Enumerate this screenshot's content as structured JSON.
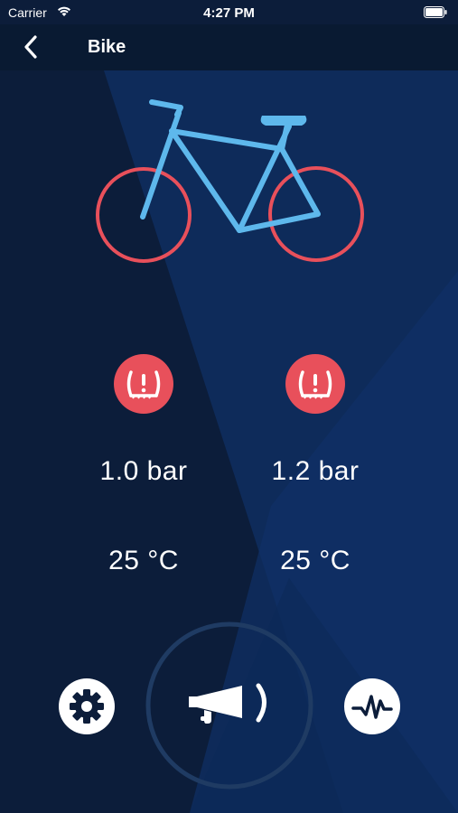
{
  "status": {
    "carrier": "Carrier",
    "time": "4:27 PM"
  },
  "nav": {
    "title": "Bike",
    "back_icon": "chevron-left-icon"
  },
  "colors": {
    "background": "#0c1d3a",
    "bike_frame": "#5eb8ec",
    "wheel": "#e8505b",
    "alert": "#e8505b"
  },
  "sensors": {
    "front": {
      "pressure": "1.0 bar",
      "temperature": "25 °C",
      "icon": "tire-pressure-warning-icon"
    },
    "rear": {
      "pressure": "1.2 bar",
      "temperature": "25 °C",
      "icon": "tire-pressure-warning-icon"
    }
  },
  "controls": {
    "settings_icon": "gear-icon",
    "horn_icon": "horn-icon",
    "activity_icon": "activity-icon"
  }
}
